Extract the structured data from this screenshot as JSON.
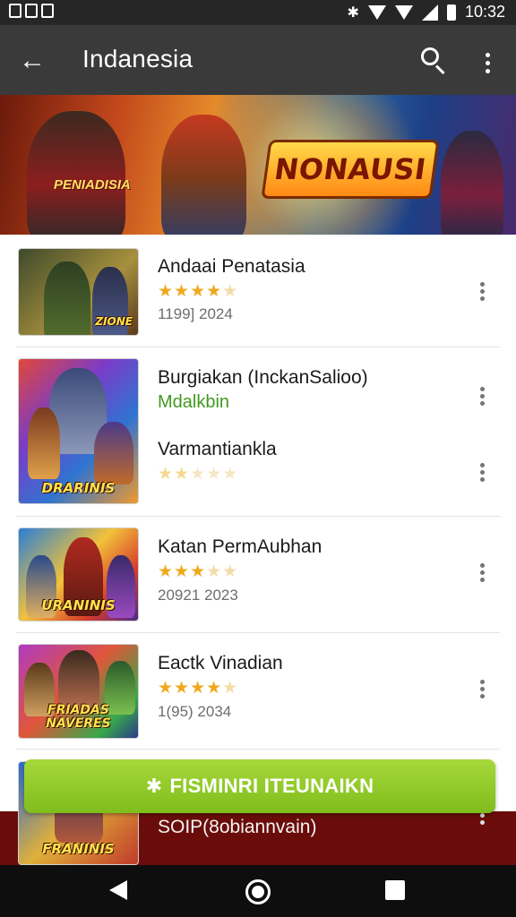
{
  "status_bar": {
    "time": "10:32"
  },
  "app_bar": {
    "title": "Indanesia"
  },
  "banner": {
    "logo_text": "NONAUSI",
    "sub_text": "PENIADISIA"
  },
  "apps": [
    {
      "title": "Andaai Penatasia",
      "stars": "★★★★★",
      "rating_on": 4,
      "meta": "1199]  2024",
      "thumb_label": "ZIONE"
    },
    {
      "title": "Burgiakan (InckanSalioo)",
      "subtitle": "Mdalkbin",
      "thumb_label": "DRARINIS"
    },
    {
      "title": "Varmantiankla",
      "stars": "★★★★★",
      "rating_on": 2
    },
    {
      "title": "Katan PermAubhan",
      "stars": "★★★★★",
      "rating_on": 3,
      "meta": "20921  2023",
      "thumb_label": "URANINIS"
    },
    {
      "title": "Eactk Vinadian",
      "stars": "★★★★★",
      "rating_on": 4,
      "meta": "1(95)  2034",
      "thumb_label": "FRIADAS NAVERES"
    },
    {
      "thumb_label": "FRANINIS"
    }
  ],
  "cta": {
    "icon": "✱",
    "label": "FISMINRI ITEUNAIKN"
  },
  "bottom_strip": {
    "text": "SOIP(8obiannvain)"
  },
  "colors": {
    "accent_green": "#8cc63f",
    "star": "#f1a81c",
    "app_bar": "#3a3a3a",
    "strip": "#6a0d0a"
  }
}
